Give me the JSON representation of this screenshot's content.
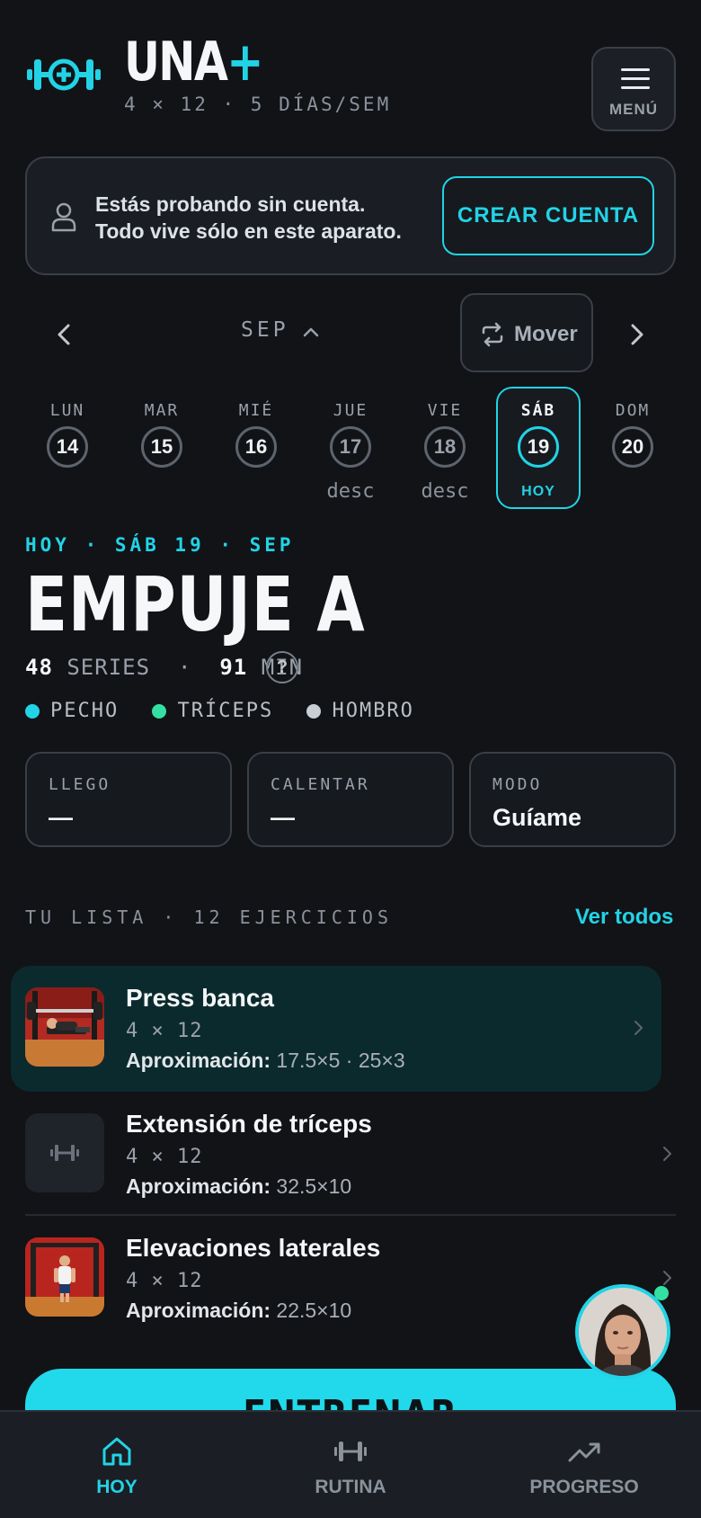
{
  "app": {
    "brand": "UNA",
    "brand_plus": "+",
    "subtitle": "4 × 12 · 5 DÍAS/SEM",
    "menu_label": "MENÚ",
    "accent_color": "#22d3e6"
  },
  "banner": {
    "text": "Estás probando sin cuenta. Todo vive sólo en este aparato.",
    "button": "CREAR CUENTA"
  },
  "calendar": {
    "month": "SEP",
    "move_label": "Mover",
    "days": [
      {
        "name": "LUN",
        "num": "14",
        "sub": ""
      },
      {
        "name": "MAR",
        "num": "15",
        "sub": ""
      },
      {
        "name": "MIÉ",
        "num": "16",
        "sub": ""
      },
      {
        "name": "JUE",
        "num": "17",
        "sub": "desc"
      },
      {
        "name": "VIE",
        "num": "18",
        "sub": "desc"
      },
      {
        "name": "SÁB",
        "num": "19",
        "sub": "HOY"
      },
      {
        "name": "DOM",
        "num": "20",
        "sub": ""
      }
    ]
  },
  "workout": {
    "date_line": "HOY · SÁB 19 · SEP",
    "title": "EMPUJE A",
    "series_count": "48",
    "series_label": "SERIES",
    "separator": "·",
    "minutes": "91",
    "minutes_label": "MIN",
    "help": "?",
    "muscles": [
      {
        "name": "PECHO",
        "color": "#22d3e6"
      },
      {
        "name": "TRÍCEPS",
        "color": "#34e0a1"
      },
      {
        "name": "HOMBRO",
        "color": "#c9ced4"
      }
    ]
  },
  "cards": [
    {
      "label": "LLEGO",
      "value": "—"
    },
    {
      "label": "CALENTAR",
      "value": "—"
    },
    {
      "label": "MODO",
      "value": "Guíame"
    }
  ],
  "list": {
    "heading": "TU LISTA · 12 EJERCICIOS",
    "view_all": "Ver todos",
    "approx_label": "Aproximación:",
    "items": [
      {
        "name": "Press banca",
        "sets": "4 × 12",
        "approx": "17.5×5 · 25×3",
        "thumb": "bench-press-photo"
      },
      {
        "name": "Extensión de tríceps",
        "sets": "4 × 12",
        "approx": "32.5×10",
        "thumb": "dumbbell-icon"
      },
      {
        "name": "Elevaciones laterales",
        "sets": "4 × 12",
        "approx": "22.5×10",
        "thumb": "lateral-raise-photo"
      }
    ]
  },
  "cta": {
    "label": "ENTRENAR"
  },
  "bottom_nav": [
    {
      "label": "HOY",
      "icon": "home-icon",
      "active": true
    },
    {
      "label": "RUTINA",
      "icon": "dumbbell-icon",
      "active": false
    },
    {
      "label": "PROGRESO",
      "icon": "trending-up-icon",
      "active": false
    }
  ]
}
